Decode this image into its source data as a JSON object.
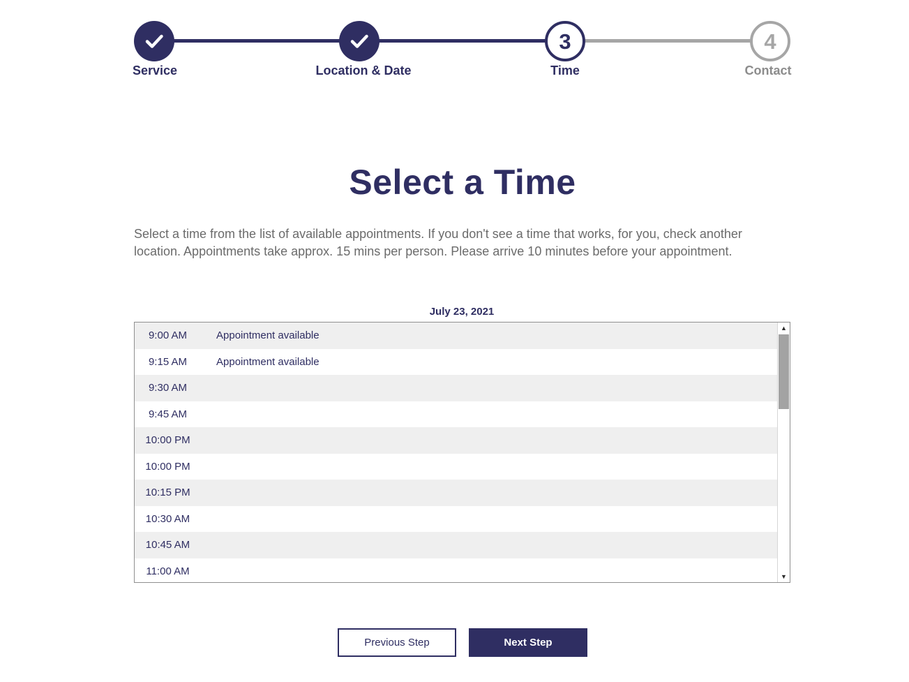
{
  "stepper": {
    "steps": [
      {
        "label": "Service",
        "number": "1",
        "state": "done"
      },
      {
        "label": "Location & Date",
        "number": "2",
        "state": "done"
      },
      {
        "label": "Time",
        "number": "3",
        "state": "current"
      },
      {
        "label": "Contact",
        "number": "4",
        "state": "todo"
      }
    ]
  },
  "page": {
    "title": "Select a Time",
    "intro": "Select a time from the list of available appointments. If you don't see a time that works, for you, check another location. Appointments take approx. 15 mins per person. Please arrive 10 minutes before your appointment."
  },
  "time_list": {
    "date": "July 23, 2021",
    "slots": [
      {
        "time": "9:00 AM",
        "status": "Appointment available"
      },
      {
        "time": "9:15 AM",
        "status": "Appointment available"
      },
      {
        "time": "9:30 AM",
        "status": ""
      },
      {
        "time": "9:45 AM",
        "status": ""
      },
      {
        "time": "10:00 PM",
        "status": ""
      },
      {
        "time": "10:00 PM",
        "status": ""
      },
      {
        "time": "10:15 PM",
        "status": ""
      },
      {
        "time": "10:30 AM",
        "status": ""
      },
      {
        "time": "10:45 AM",
        "status": ""
      },
      {
        "time": "11:00 AM",
        "status": ""
      }
    ],
    "scroll_up_icon": "triangle-up",
    "scroll_down_icon": "triangle-down"
  },
  "buttons": {
    "previous": "Previous Step",
    "next": "Next Step"
  },
  "colors": {
    "brand": "#2f2e62",
    "inactive": "#a6a6a6"
  }
}
